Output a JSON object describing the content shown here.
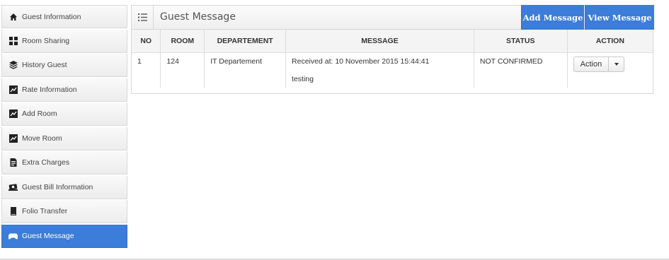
{
  "sidebar": {
    "items": [
      {
        "label": "Guest Information",
        "icon": "home-icon",
        "active": false
      },
      {
        "label": "Room Sharing",
        "icon": "grid-icon",
        "active": false
      },
      {
        "label": "History Guest",
        "icon": "layers-icon",
        "active": false
      },
      {
        "label": "Rate Information",
        "icon": "chart-icon",
        "active": false
      },
      {
        "label": "Add Room",
        "icon": "chart-icon",
        "active": false
      },
      {
        "label": "Move Room",
        "icon": "chart-icon",
        "active": false
      },
      {
        "label": "Extra Charges",
        "icon": "document-icon",
        "active": false
      },
      {
        "label": "Guest Bill Information",
        "icon": "money-icon",
        "active": false
      },
      {
        "label": "Folio Transfer",
        "icon": "book-icon",
        "active": false
      },
      {
        "label": "Guest Message",
        "icon": "gamepad-icon",
        "active": true
      }
    ]
  },
  "panel": {
    "title": "Guest Message",
    "add_label": "Add Message",
    "view_label": "View Message"
  },
  "table": {
    "columns": [
      "NO",
      "ROOM",
      "DEPARTEMENT",
      "MESSAGE",
      "STATUS",
      "ACTION"
    ],
    "rows": [
      {
        "no": "1",
        "room": "124",
        "department": "IT Departement",
        "message_time": "Received at: 10 November 2015 15:44:41",
        "message_text": "testing",
        "status": "NOT CONFIRMED",
        "action_label": "Action"
      }
    ]
  },
  "colors": {
    "accent": "#3b7dd8"
  }
}
